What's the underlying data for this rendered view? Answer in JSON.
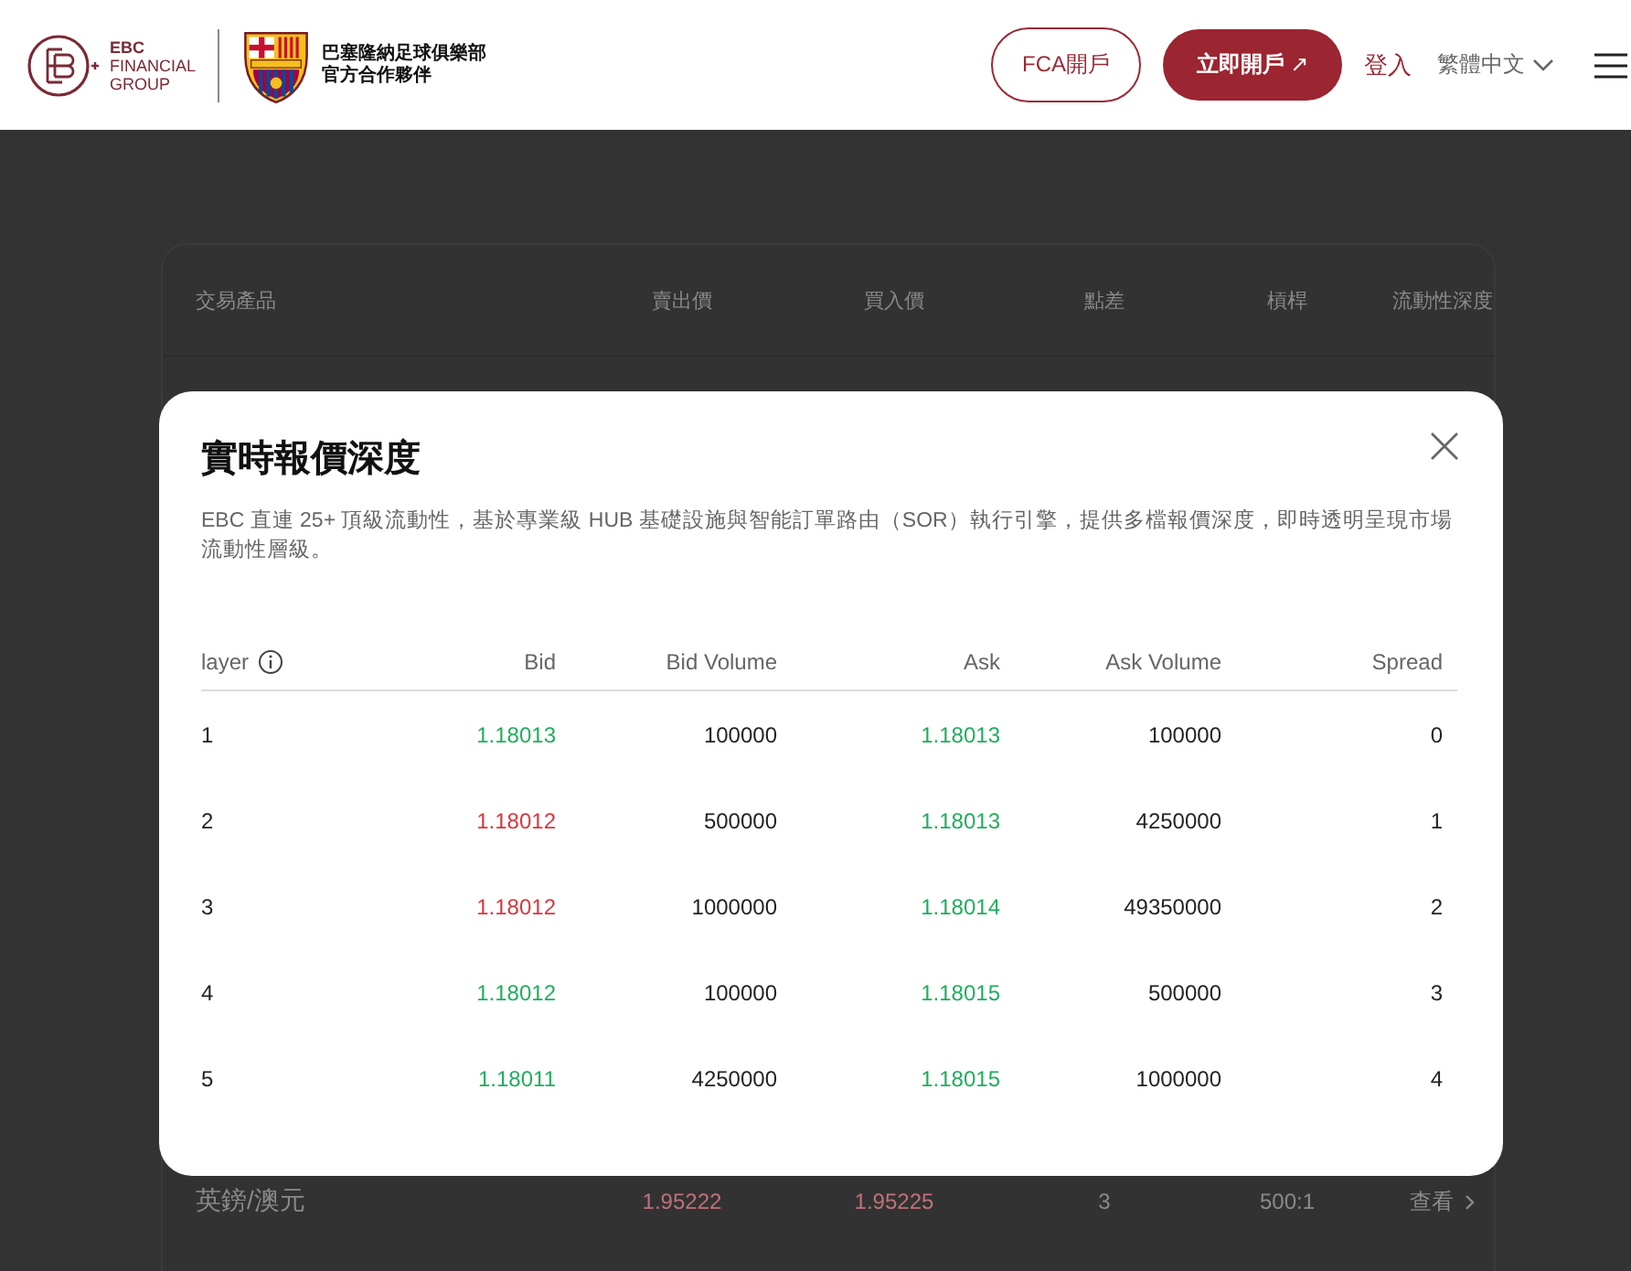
{
  "header": {
    "brand_lines": [
      "EBC",
      "FINANCIAL",
      "GROUP"
    ],
    "partner_lines": [
      "巴塞隆納足球俱樂部",
      "官方合作夥伴"
    ],
    "fca_button": "FCA開戶",
    "open_button": "立即開戶",
    "open_arrow": "↗",
    "login": "登入",
    "language": "繁體中文"
  },
  "page": {
    "table": {
      "columns": [
        "交易產品",
        "賣出價",
        "買入價",
        "點差",
        "槓桿",
        "流動性深度"
      ],
      "rows": [
        {
          "product": "英鎊/澳元",
          "sell": "1.95222",
          "buy": "1.95225",
          "spread": "3",
          "leverage": "500:1",
          "action": "查看"
        }
      ]
    }
  },
  "modal": {
    "title": "實時報價深度",
    "description": "EBC 直連 25+ 頂級流動性，基於專業級 HUB 基礎設施與智能訂單路由（SOR）執行引擎，提供多檔報價深度，即時透明呈現市場流動性層級。",
    "columns": [
      "layer",
      "Bid",
      "Bid Volume",
      "Ask",
      "Ask Volume",
      "Spread"
    ],
    "rows": [
      {
        "layer": "1",
        "bid": {
          "value": "1.18013",
          "color": "#1fae5c"
        },
        "bid_volume": "100000",
        "ask": {
          "value": "1.18013",
          "color": "#1fae5c"
        },
        "ask_volume": "100000",
        "spread": "0"
      },
      {
        "layer": "2",
        "bid": {
          "value": "1.18012",
          "color": "#d9363e"
        },
        "bid_volume": "500000",
        "ask": {
          "value": "1.18013",
          "color": "#1fae5c"
        },
        "ask_volume": "4250000",
        "spread": "1"
      },
      {
        "layer": "3",
        "bid": {
          "value": "1.18012",
          "color": "#d9363e"
        },
        "bid_volume": "1000000",
        "ask": {
          "value": "1.18014",
          "color": "#1fae5c"
        },
        "ask_volume": "49350000",
        "spread": "2"
      },
      {
        "layer": "4",
        "bid": {
          "value": "1.18012",
          "color": "#1fae5c"
        },
        "bid_volume": "100000",
        "ask": {
          "value": "1.18015",
          "color": "#1fae5c"
        },
        "ask_volume": "500000",
        "spread": "3"
      },
      {
        "layer": "5",
        "bid": {
          "value": "1.18011",
          "color": "#1fae5c"
        },
        "bid_volume": "4250000",
        "ask": {
          "value": "1.18015",
          "color": "#1fae5c"
        },
        "ask_volume": "1000000",
        "spread": "4"
      }
    ]
  }
}
